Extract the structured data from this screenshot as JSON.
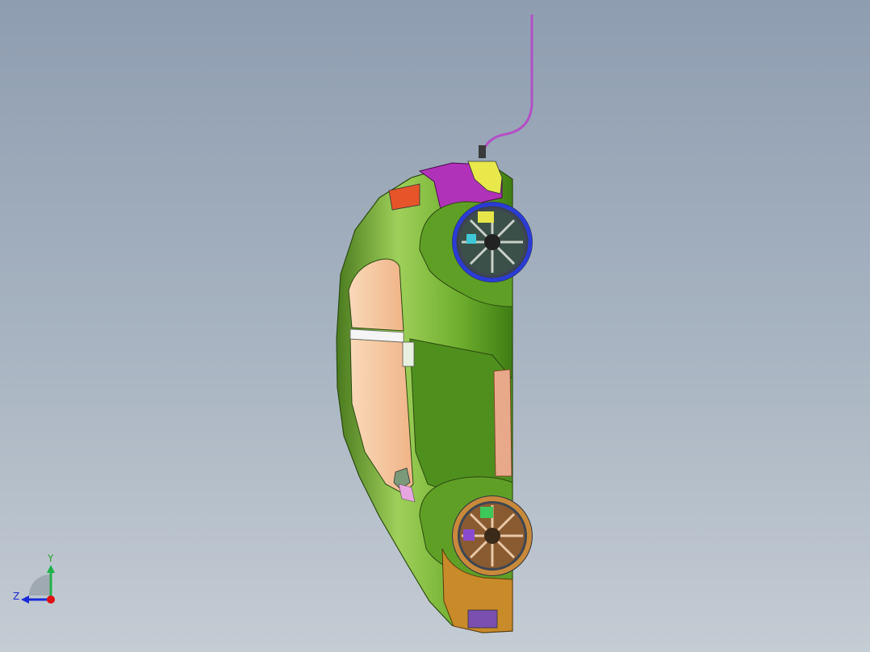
{
  "viewport": {
    "background_top": "#8e9db0",
    "background_bottom": "#c4ccd4"
  },
  "model": {
    "body_color": "#7bb83a",
    "glass_color": "#f5c6a0",
    "front_fender_color": "#b032b8",
    "rear_bumper_color": "#c98a2a",
    "front_wheel_rim_color": "#2a3bd6",
    "rear_wheel_rim_color": "#c8893a",
    "cable_color": "#b34fc4"
  },
  "triad": {
    "y_label": "Y",
    "z_label": "Z",
    "y_color": "#22b14c",
    "z_color": "#1a2ad6",
    "x_color": "#e01010"
  }
}
